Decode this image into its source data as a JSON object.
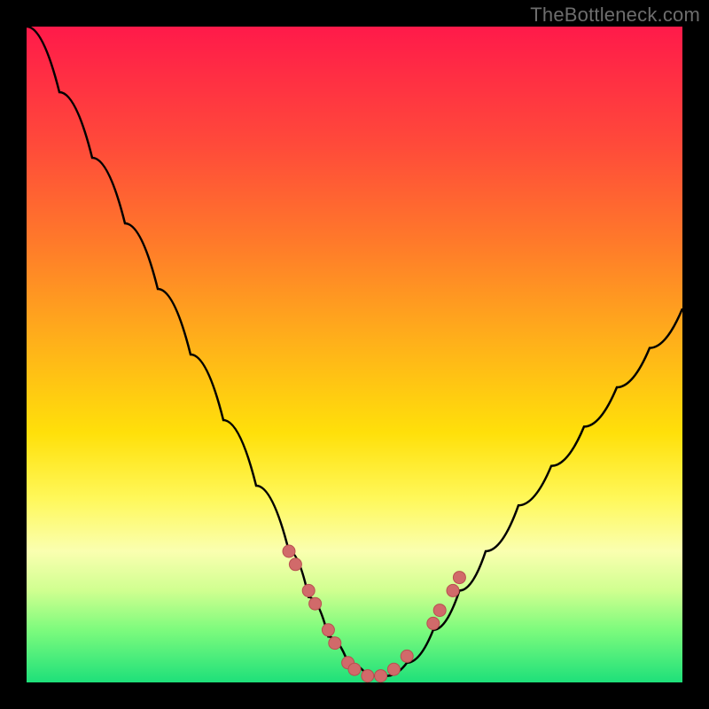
{
  "watermark": "TheBottleneck.com",
  "colors": {
    "frame": "#000000",
    "curve_stroke": "#000000",
    "dot_fill": "#d16a6a",
    "dot_stroke": "#b85050"
  },
  "chart_data": {
    "type": "line",
    "title": "",
    "xlabel": "",
    "ylabel": "",
    "xlim": [
      0,
      100
    ],
    "ylim": [
      0,
      100
    ],
    "series": [
      {
        "name": "bottleneck-curve",
        "x": [
          0,
          5,
          10,
          15,
          20,
          25,
          30,
          35,
          40,
          43,
          46,
          49,
          52,
          55,
          58,
          62,
          66,
          70,
          75,
          80,
          85,
          90,
          95,
          100
        ],
        "y": [
          100,
          90,
          80,
          70,
          60,
          50,
          40,
          30,
          20,
          13,
          7,
          3,
          1,
          1,
          3,
          8,
          14,
          20,
          27,
          33,
          39,
          45,
          51,
          57
        ]
      }
    ],
    "highlight_dots": {
      "name": "valley-markers",
      "x": [
        40,
        41,
        43,
        44,
        46,
        47,
        49,
        50,
        52,
        54,
        56,
        58,
        62,
        63,
        65,
        66
      ],
      "y": [
        20,
        18,
        14,
        12,
        8,
        6,
        3,
        2,
        1,
        1,
        2,
        4,
        9,
        11,
        14,
        16
      ]
    }
  }
}
